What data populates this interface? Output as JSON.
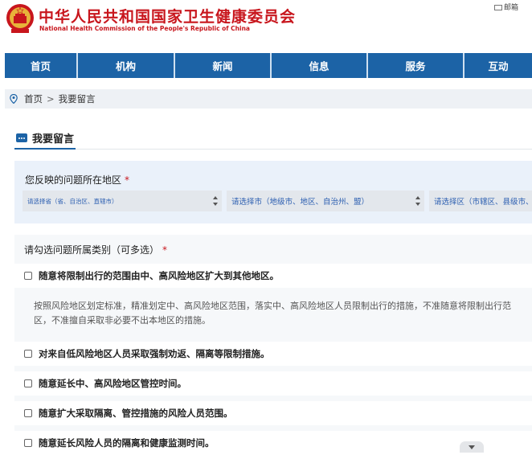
{
  "header": {
    "title_cn": "中华人民共和国国家卫生健康委员会",
    "title_en": "National Health Commission of the People's Republic of China",
    "mail_label": "邮箱"
  },
  "nav": {
    "items": [
      {
        "label": "首页"
      },
      {
        "label": "机构"
      },
      {
        "label": "新闻"
      },
      {
        "label": "信息"
      },
      {
        "label": "服务"
      },
      {
        "label": "互动"
      }
    ]
  },
  "breadcrumb": {
    "home": "首页",
    "separator": ">",
    "current": "我要留言"
  },
  "section": {
    "title": "我要留言"
  },
  "region": {
    "label": "您反映的问题所在地区",
    "required_mark": "*",
    "province_placeholder": "请选择省（省、自治区、直辖市）",
    "city_placeholder": "请选择市（地级市、地区、自治州、盟）",
    "district_placeholder": "请选择区（市辖区、县级市、"
  },
  "category": {
    "label": "请勾选问题所属类别（可多选）",
    "required_mark": "*",
    "options": [
      {
        "label": "随意将限制出行的范围由中、高风险地区扩大到其他地区。"
      },
      {
        "label": "对来自低风险地区人员采取强制劝返、隔离等限制措施。"
      },
      {
        "label": "随意延长中、高风险地区管控时间。"
      },
      {
        "label": "随意扩大采取隔离、管控措施的风险人员范围。"
      },
      {
        "label": "随意延长风险人员的隔离和健康监测时间。"
      }
    ],
    "description_line1": "按照风险地区划定标准，精准划定中、高风险地区范围，落实中、高风险地区人员限制出行的措施，不准随意将限制出行范",
    "description_line2": "区，不准擅自采取非必要不出本地区的措施。"
  },
  "colors": {
    "brand_red": "#c8161d",
    "nav_blue": "#1c63a6",
    "panel_blue": "#eaf1fa"
  }
}
